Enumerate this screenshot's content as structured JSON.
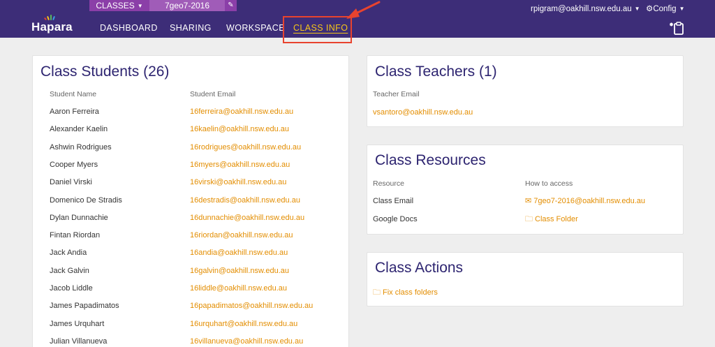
{
  "header": {
    "classes_label": "CLASSES",
    "class_name": "7geo7-2016",
    "logo_text": "Hapara",
    "nav": [
      "DASHBOARD",
      "SHARING",
      "WORKSPACE",
      "CLASS INFO"
    ],
    "active_nav": "CLASS INFO",
    "user_email": "rpigram@oakhill.nsw.edu.au",
    "config_label": "Config"
  },
  "students": {
    "title": "Class Students (26)",
    "col_name": "Student Name",
    "col_email": "Student Email",
    "rows": [
      {
        "name": "Aaron Ferreira",
        "email": "16ferreira@oakhill.nsw.edu.au"
      },
      {
        "name": "Alexander Kaelin",
        "email": "16kaelin@oakhill.nsw.edu.au"
      },
      {
        "name": "Ashwin Rodrigues",
        "email": "16rodrigues@oakhill.nsw.edu.au"
      },
      {
        "name": "Cooper Myers",
        "email": "16myers@oakhill.nsw.edu.au"
      },
      {
        "name": "Daniel Virski",
        "email": "16virski@oakhill.nsw.edu.au"
      },
      {
        "name": "Domenico De Stradis",
        "email": "16destradis@oakhill.nsw.edu.au"
      },
      {
        "name": "Dylan Dunnachie",
        "email": "16dunnachie@oakhill.nsw.edu.au"
      },
      {
        "name": "Fintan Riordan",
        "email": "16riordan@oakhill.nsw.edu.au"
      },
      {
        "name": "Jack Andia",
        "email": "16andia@oakhill.nsw.edu.au"
      },
      {
        "name": "Jack Galvin",
        "email": "16galvin@oakhill.nsw.edu.au"
      },
      {
        "name": "Jacob Liddle",
        "email": "16liddle@oakhill.nsw.edu.au"
      },
      {
        "name": "James Papadimatos",
        "email": "16papadimatos@oakhill.nsw.edu.au"
      },
      {
        "name": "James Urquhart",
        "email": "16urquhart@oakhill.nsw.edu.au"
      },
      {
        "name": "Julian Villanueva",
        "email": "16villanueva@oakhill.nsw.edu.au"
      }
    ]
  },
  "teachers": {
    "title": "Class Teachers (1)",
    "col_email": "Teacher Email",
    "rows": [
      {
        "email": "vsantoro@oakhill.nsw.edu.au"
      }
    ]
  },
  "resources": {
    "title": "Class Resources",
    "col_resource": "Resource",
    "col_access": "How to access",
    "rows": [
      {
        "resource": "Class Email",
        "access": "7geo7-2016@oakhill.nsw.edu.au",
        "icon": "envelope-icon"
      },
      {
        "resource": "Google Docs",
        "access": "Class Folder",
        "icon": "folder-icon"
      }
    ]
  },
  "actions": {
    "title": "Class Actions",
    "items": [
      {
        "label": "Fix class folders",
        "icon": "folder-icon"
      }
    ]
  },
  "colors": {
    "topbar": "#3d2d78",
    "accent_purple": "#8b3fa8",
    "link_orange": "#e38d00",
    "active_nav": "#f5c518",
    "annotation_red": "#e8432e",
    "title_navy": "#2d2470"
  }
}
